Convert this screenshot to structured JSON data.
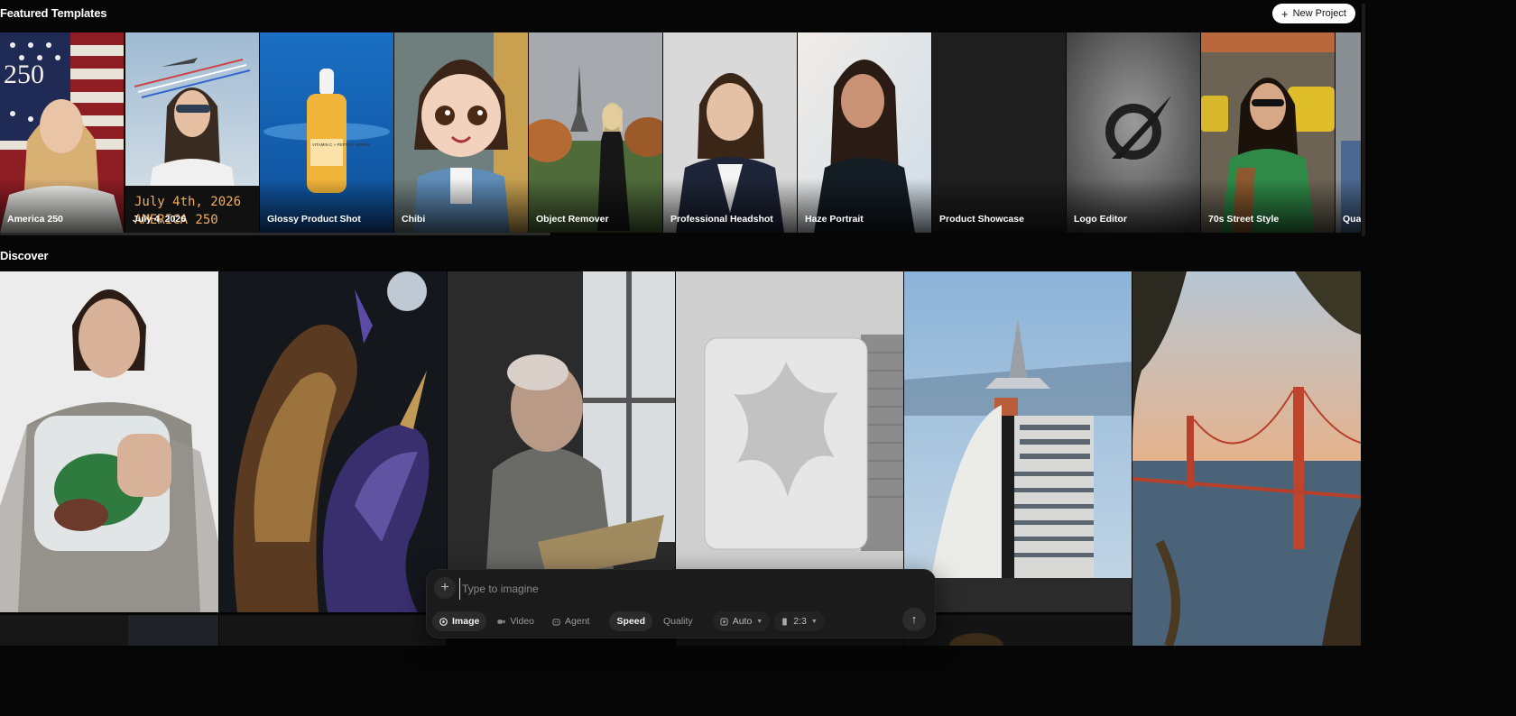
{
  "featured": {
    "title": "Featured Templates",
    "new_project_label": "New Project",
    "templates": [
      {
        "label": "America 250"
      },
      {
        "label": "July 4, 2026",
        "overlay_line1": "July 4th, 2026",
        "overlay_line2": "AMERICA 250"
      },
      {
        "label": "Glossy Product Shot",
        "bottle_text": "VITAMIN C + PEPTIDE SERUM"
      },
      {
        "label": "Chibi"
      },
      {
        "label": "Object Remover"
      },
      {
        "label": "Professional Headshot"
      },
      {
        "label": "Haze Portrait"
      },
      {
        "label": "Product Showcase"
      },
      {
        "label": "Logo Editor"
      },
      {
        "label": "70s Street Style"
      },
      {
        "label": "Qua"
      }
    ],
    "america_number": "250"
  },
  "discover": {
    "title": "Discover",
    "tiles": [
      {
        "name": "woman-with-greens-bag"
      },
      {
        "name": "dragons-night"
      },
      {
        "name": "old-man-reading"
      },
      {
        "name": "clay-star-sculpture"
      },
      {
        "name": "futuristic-tower"
      },
      {
        "name": "golden-gate-bridge"
      }
    ]
  },
  "prompt": {
    "placeholder": "Type to imagine",
    "modes": [
      {
        "label": "Image",
        "active": true
      },
      {
        "label": "Video",
        "active": false
      },
      {
        "label": "Agent",
        "active": false
      }
    ],
    "quality_modes": [
      {
        "label": "Speed",
        "active": true
      },
      {
        "label": "Quality",
        "active": false
      }
    ],
    "model_select": "Auto",
    "aspect_select": "2:3"
  },
  "colors": {
    "background": "#060606",
    "panel": "#1b1b1b",
    "chip_active": "#2b2b2b"
  }
}
